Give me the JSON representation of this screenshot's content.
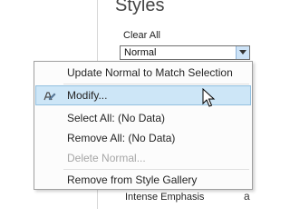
{
  "pane": {
    "title": "Styles",
    "clear_all": "Clear All",
    "selected_style": "Normal",
    "bottom_item": "Intense Emphasis",
    "bottom_preview": "a"
  },
  "menu": {
    "items": [
      {
        "label": "Update Normal to Match Selection",
        "enabled": true
      },
      {
        "label": "Modify...",
        "enabled": true,
        "highlighted": true,
        "icon": "pencil-a-icon"
      },
      {
        "label": "Select All: (No Data)",
        "enabled": true
      },
      {
        "label": "Remove All: (No Data)",
        "enabled": true
      },
      {
        "label": "Delete Normal...",
        "enabled": false
      },
      {
        "label": "Remove from Style Gallery",
        "enabled": true
      }
    ]
  },
  "colors": {
    "highlight_bg": "#cde6f7",
    "highlight_border": "#92c0e0",
    "disabled_text": "#a6a6a6"
  }
}
